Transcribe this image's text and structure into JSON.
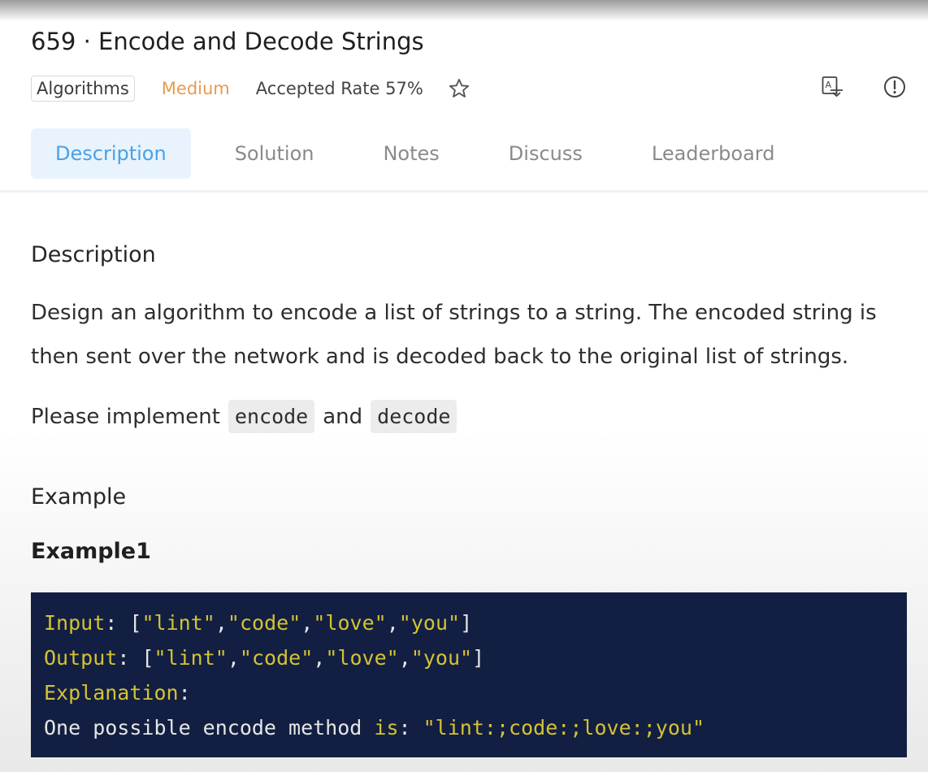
{
  "problem": {
    "title": "659 · Encode and Decode Strings",
    "tag": "Algorithms",
    "difficulty": "Medium",
    "accepted_rate": "Accepted Rate 57%",
    "icons": {
      "favorite": "star-icon",
      "translate": "translate-icon",
      "report": "alert-circle-icon"
    },
    "colors": {
      "difficulty": "#e59b50",
      "active_tab_text": "#4aa0e6",
      "active_tab_bg": "#e8f3fd",
      "code_bg": "#121f42",
      "code_keyword": "#d4c234"
    }
  },
  "tabs": [
    {
      "label": "Description",
      "active": true
    },
    {
      "label": "Solution",
      "active": false
    },
    {
      "label": "Notes",
      "active": false
    },
    {
      "label": "Discuss",
      "active": false
    },
    {
      "label": "Leaderboard",
      "active": false
    }
  ],
  "content": {
    "description_heading": "Description",
    "description_text": "Design an algorithm to encode a list of strings to a string. The encoded string is then sent over the network and is decoded back to the original list of strings.",
    "implement_prefix": "Please implement",
    "implement_encode": "encode",
    "implement_and": "and",
    "implement_decode": "decode",
    "example_heading": "Example",
    "example1_heading": "Example1",
    "example1": {
      "input_label": "Input",
      "input_value": "[\"lint\",\"code\",\"love\",\"you\"]",
      "output_label": "Output",
      "output_value": "[\"lint\",\"code\",\"love\",\"you\"]",
      "explanation_label": "Explanation",
      "explanation_prefix": "One possible encode method ",
      "explanation_is": "is",
      "explanation_value": "\"lint:;code:;love:;you\""
    }
  }
}
